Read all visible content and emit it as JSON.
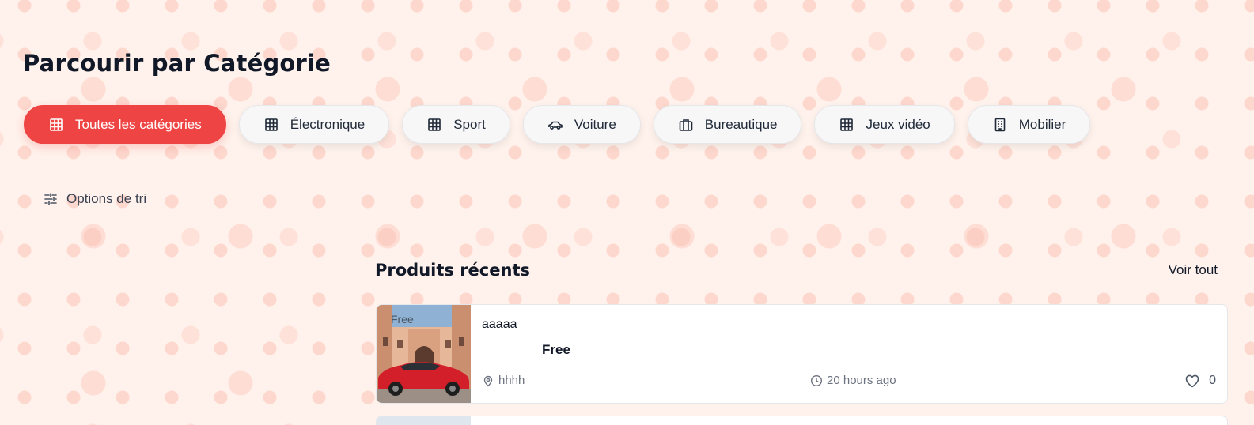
{
  "header": {
    "title": "Parcourir par Catégorie"
  },
  "categories": [
    {
      "label": "Toutes les catégories",
      "icon": "grid-icon",
      "active": true
    },
    {
      "label": "Électronique",
      "icon": "grid-icon",
      "active": false
    },
    {
      "label": "Sport",
      "icon": "grid-icon",
      "active": false
    },
    {
      "label": "Voiture",
      "icon": "car-icon",
      "active": false
    },
    {
      "label": "Bureautique",
      "icon": "briefcase-icon",
      "active": false
    },
    {
      "label": "Jeux vidéo",
      "icon": "grid-icon",
      "active": false
    },
    {
      "label": "Mobilier",
      "icon": "building-icon",
      "active": false
    }
  ],
  "sort": {
    "label": "Options de tri",
    "icon": "sliders-icon"
  },
  "recent": {
    "title": "Produits récents",
    "see_all_label": "Voir tout",
    "products": [
      {
        "image_badge": "Free",
        "name": "aaaaa",
        "price": "Free",
        "location": "hhhh",
        "time": "20 hours ago",
        "likes": "0"
      }
    ]
  },
  "colors": {
    "accent": "#ef4444",
    "background": "#fff2ec",
    "chip_background": "#f7f7f8"
  }
}
